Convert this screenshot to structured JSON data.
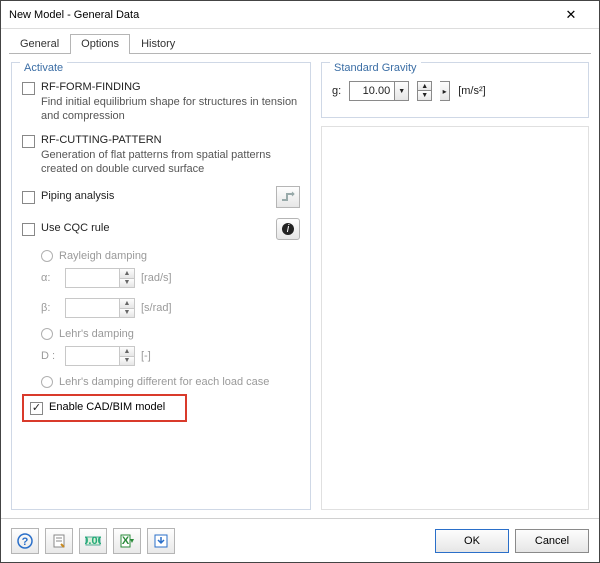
{
  "window": {
    "title": "New Model - General Data"
  },
  "tabs": {
    "general": "General",
    "options": "Options",
    "history": "History"
  },
  "activate": {
    "legend": "Activate",
    "form_finding": {
      "title": "RF-FORM-FINDING",
      "desc": "Find initial equilibrium shape for structures in tension and compression"
    },
    "cutting": {
      "title": "RF-CUTTING-PATTERN",
      "desc": "Generation of flat patterns from spatial patterns created on double curved surface"
    },
    "piping": "Piping analysis",
    "cqc": "Use CQC rule",
    "rayleigh": "Rayleigh damping",
    "alpha": "α:",
    "alpha_unit": "[rad/s]",
    "beta": "β:",
    "beta_unit": "[s/rad]",
    "lehr": "Lehr's damping",
    "d_label": "D :",
    "d_unit": "[-]",
    "lehr_diff": "Lehr's damping different for each load case",
    "enable_cad": "Enable CAD/BIM model"
  },
  "gravity": {
    "legend": "Standard Gravity",
    "g_label": "g:",
    "value": "10.00",
    "unit": "[m/s²]"
  },
  "buttons": {
    "ok": "OK",
    "cancel": "Cancel"
  }
}
